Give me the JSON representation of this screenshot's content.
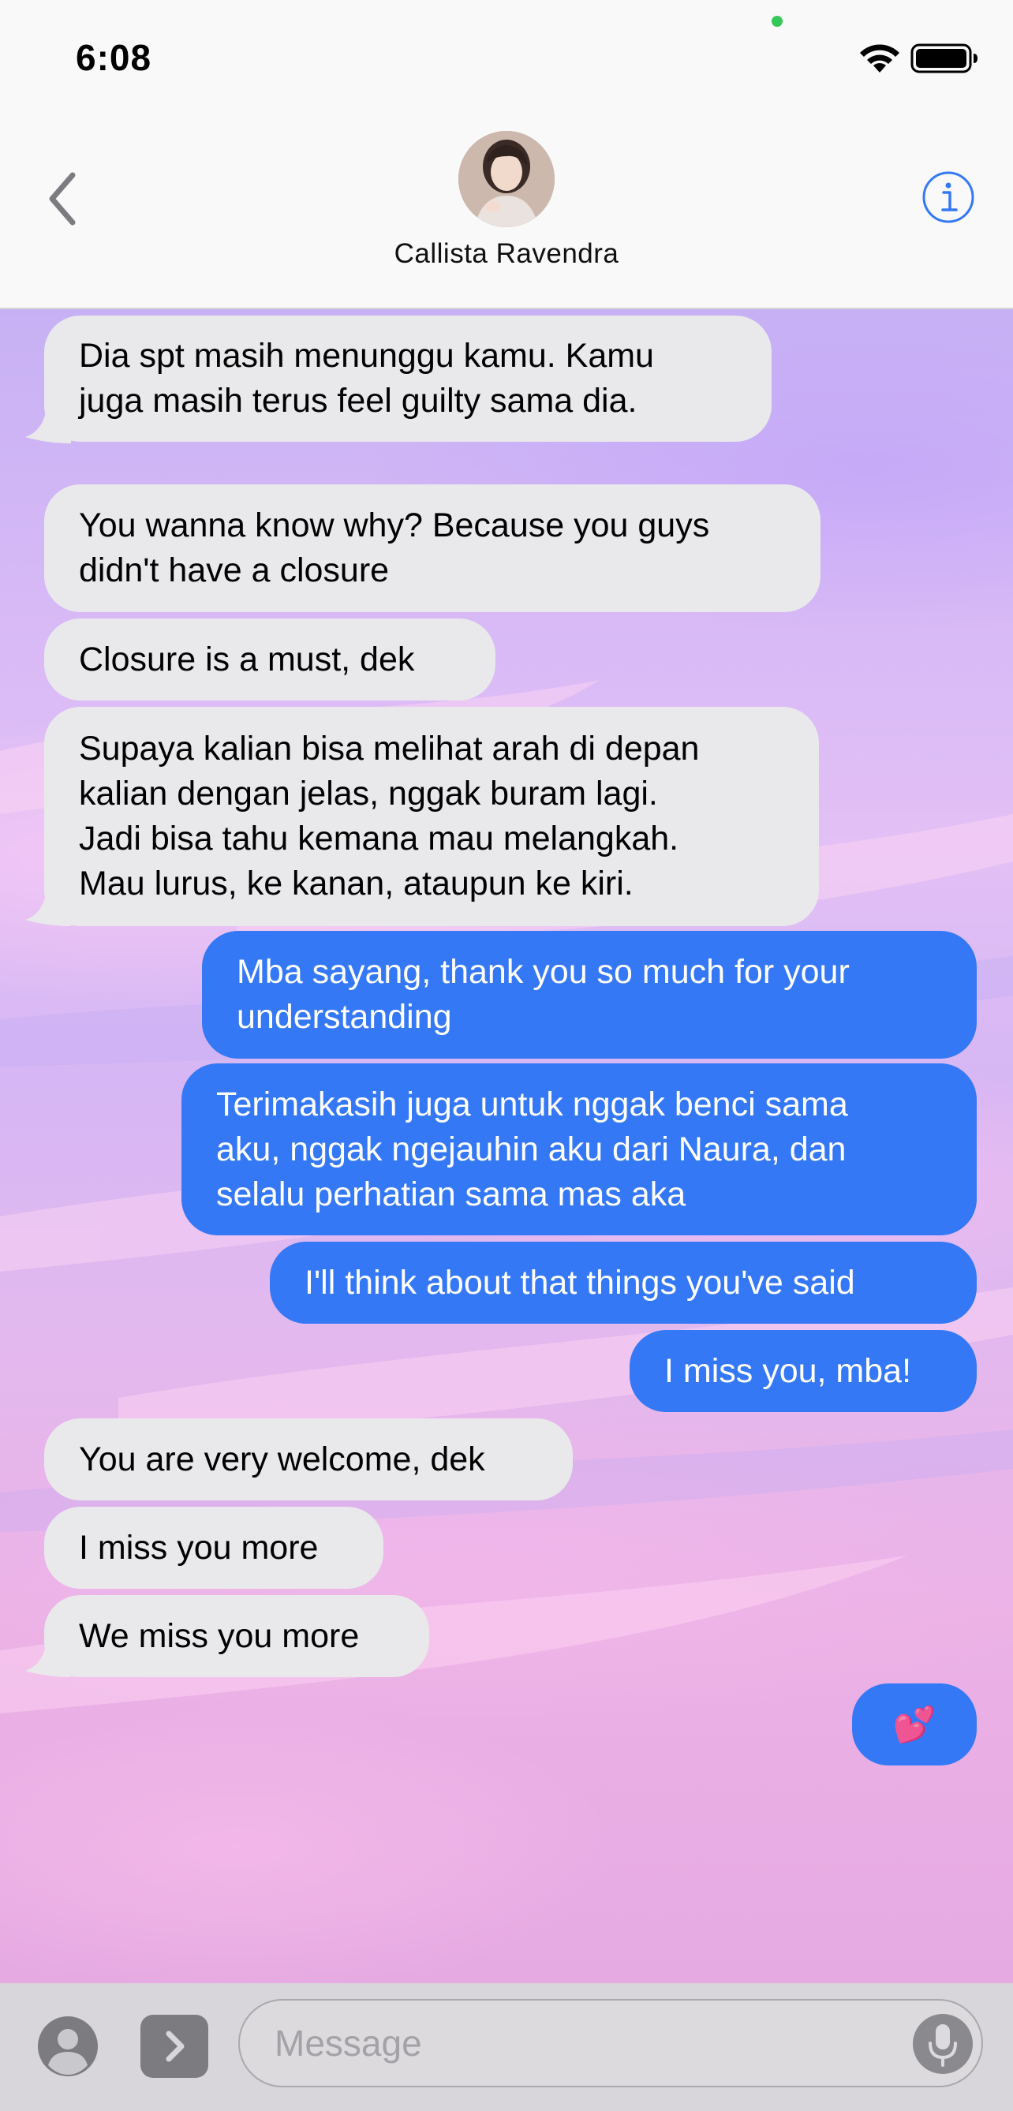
{
  "status_bar": {
    "time": "6:08"
  },
  "header": {
    "contact_name": "Callista Ravendra",
    "icons": {
      "back": "chevron-left-icon",
      "info": "info-circle-icon",
      "avatar": "contact-photo"
    }
  },
  "messages": [
    {
      "direction": "incoming",
      "lines": [
        "Dia spt masih menunggu kamu. Kamu",
        "juga masih terus feel guilty sama dia."
      ]
    },
    {
      "direction": "incoming",
      "lines": [
        "You wanna know why? Because you guys",
        "didn't have a closure"
      ]
    },
    {
      "direction": "incoming",
      "lines": [
        "Closure is a must, dek"
      ]
    },
    {
      "direction": "incoming",
      "lines": [
        "Supaya kalian bisa melihat arah di depan",
        "kalian dengan jelas, nggak buram lagi.",
        "Jadi bisa tahu kemana mau melangkah.",
        "Mau lurus, ke kanan, ataupun ke kiri."
      ]
    },
    {
      "direction": "outgoing",
      "lines": [
        "Mba sayang, thank you so much for your",
        "understanding"
      ]
    },
    {
      "direction": "outgoing",
      "lines": [
        "Terimakasih juga untuk nggak benci sama",
        "aku, nggak ngejauhin aku dari Naura, dan",
        "selalu perhatian sama mas aka"
      ]
    },
    {
      "direction": "outgoing",
      "lines": [
        "I'll think about that things you've said"
      ]
    },
    {
      "direction": "outgoing",
      "lines": [
        "I miss you, mba!"
      ]
    },
    {
      "direction": "incoming",
      "lines": [
        "You are very welcome, dek"
      ]
    },
    {
      "direction": "incoming",
      "lines": [
        "I miss you more"
      ]
    },
    {
      "direction": "incoming",
      "lines": [
        "We miss you more"
      ]
    },
    {
      "direction": "outgoing",
      "lines": [
        "💕"
      ]
    }
  ],
  "input_bar": {
    "placeholder": "Message",
    "icons": {
      "contact": "person-circle-icon",
      "apps": "chevron-right-icon",
      "mic": "microphone-icon"
    }
  },
  "colors": {
    "incoming_bubble": "#e9e9eb",
    "outgoing_bubble": "#3478f6",
    "accent": "#3478f6"
  }
}
